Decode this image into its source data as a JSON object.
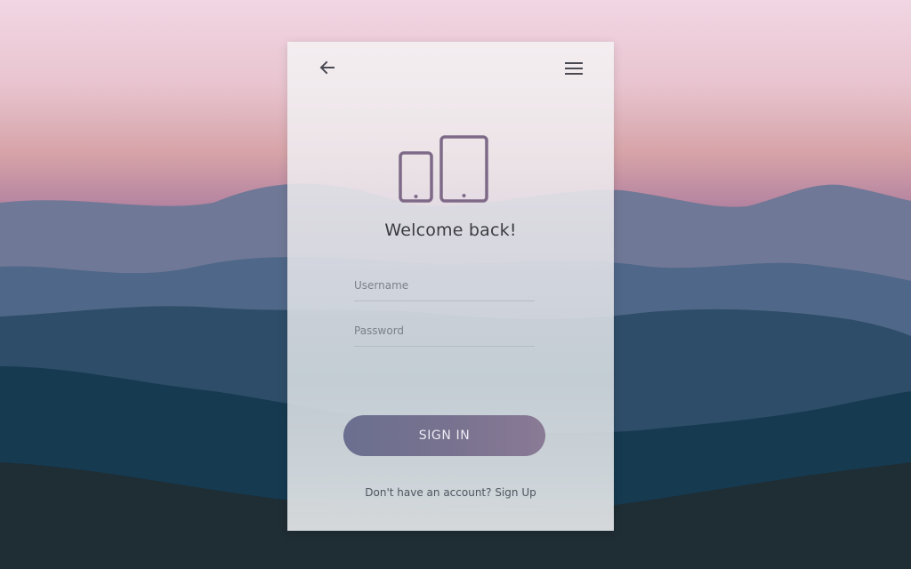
{
  "nav": {
    "back_icon": "arrow-left-icon",
    "menu_icon": "hamburger-menu-icon"
  },
  "hero": {
    "icon": "phone-tablet-devices-icon",
    "title": "Welcome back!"
  },
  "form": {
    "username_placeholder": "Username",
    "password_placeholder": "Password",
    "submit_label": "SIGN IN"
  },
  "footer": {
    "prompt": "Don't have an account?",
    "link": "Sign Up"
  },
  "colors": {
    "accent": "#75728f",
    "icon": "#7e6a88",
    "text": "#3b3b41"
  }
}
